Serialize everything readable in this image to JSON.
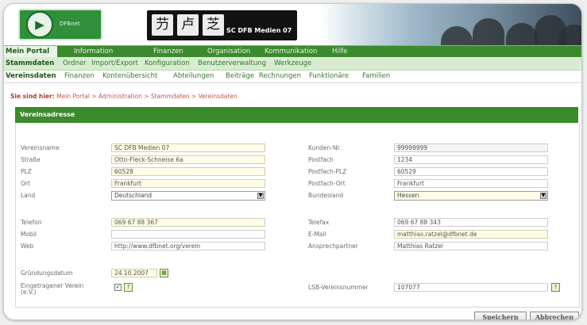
{
  "logo": {
    "text": "DFBnet"
  },
  "club": {
    "name": "SC DFB Medien 07",
    "pics": [
      "芀",
      "卢",
      "芝"
    ]
  },
  "nav1": {
    "active": "Mein Portal",
    "items": [
      "Information",
      "Finanzen",
      "Organisation",
      "Kommunikation",
      "Hilfe"
    ]
  },
  "nav2": {
    "active": "Stammdaten",
    "items": [
      "Ordner",
      "Import/Export",
      "Konfiguration",
      "Benutzerverwaltung",
      "Werkzeuge"
    ]
  },
  "nav3": {
    "active": "Vereinsdaten",
    "items": [
      "Finanzen",
      "Kontenübersicht",
      "Abteilungen",
      "Beiträge",
      "Rechnungen",
      "Funktionäre",
      "Familien"
    ]
  },
  "breadcrumb": {
    "label": "Sie sind hier:",
    "path": "Mein Portal > Administration > Stammdaten > Vereinsdaten"
  },
  "panel": {
    "title": "Vereinsadresse"
  },
  "form": {
    "vereinsname": {
      "label": "Vereinsname",
      "value": "SC DFB Medien 07"
    },
    "strasse": {
      "label": "Straße",
      "value": "Otto-Fleck-Schneise 6a"
    },
    "plz": {
      "label": "PLZ",
      "value": "60528"
    },
    "ort": {
      "label": "Ort",
      "value": "Frankfurt"
    },
    "land": {
      "label": "Land",
      "value": "Deutschland"
    },
    "kundennr": {
      "label": "Kunden-Nr.",
      "value": "99999999"
    },
    "postfach": {
      "label": "Postfach",
      "value": "1234"
    },
    "postfach_plz": {
      "label": "Postfach-PLZ",
      "value": "60529"
    },
    "postfach_ort": {
      "label": "Postfach-Ort",
      "value": "Frankfurt"
    },
    "bundesland": {
      "label": "Bundesland",
      "value": "Hessen"
    },
    "telefon": {
      "label": "Telefon",
      "value": "069 67 88 367"
    },
    "mobil": {
      "label": "Mobil",
      "value": ""
    },
    "web": {
      "label": "Web",
      "value": "http://www.dfbnet.org/verein"
    },
    "telefax": {
      "label": "Telefax",
      "value": "069 67 88 343"
    },
    "email": {
      "label": "E-Mail",
      "value": "matthias.ratzel@dfbnet.de"
    },
    "ansprechpartner": {
      "label": "Ansprechpartner",
      "value": "Matthias Ratzel"
    },
    "gruendung": {
      "label": "Gründungsdatum",
      "value": "24.10.2007"
    },
    "ev": {
      "label": "Eingetragener Verein (e.V.)",
      "checked": true
    },
    "lsb": {
      "label": "LSB-Vereinsnummer",
      "value": "107077"
    }
  },
  "buttons": {
    "save": "Speichern",
    "cancel": "Abbrechen"
  },
  "colors": {
    "primary_green": "#3b8b2c",
    "required_field": "#fffce8"
  }
}
